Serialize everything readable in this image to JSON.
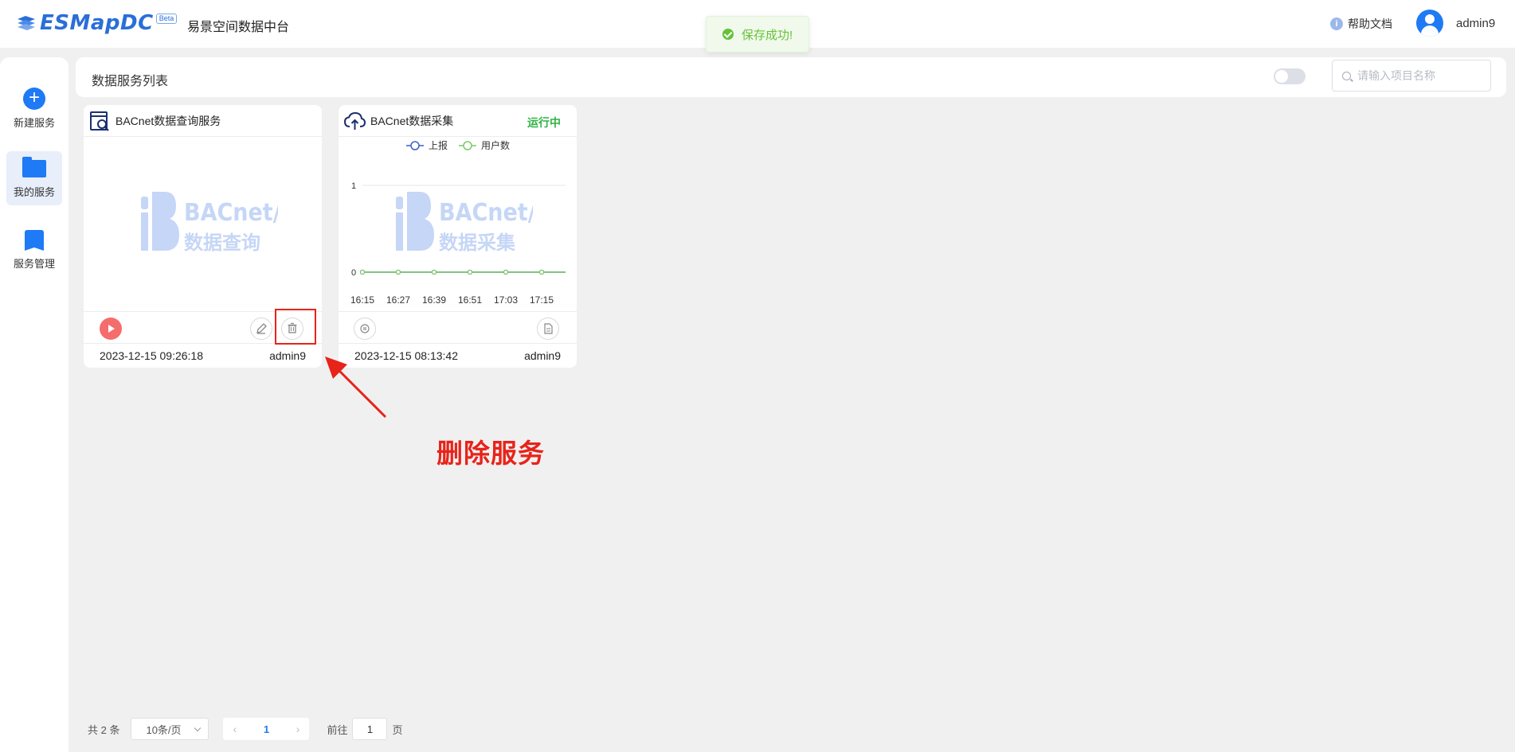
{
  "header": {
    "logo_text": "ESMapDC",
    "logo_badge": "Beta",
    "app_name": "易景空间数据中台",
    "help_label": "帮助文档",
    "username": "admin9"
  },
  "toast": {
    "message": "保存成功!"
  },
  "sidebar": {
    "items": [
      {
        "label": "新建服务",
        "icon": "plus-circle-icon"
      },
      {
        "label": "我的服务",
        "icon": "folder-icon",
        "active": true
      },
      {
        "label": "服务管理",
        "icon": "book-icon"
      }
    ]
  },
  "toolbar": {
    "title": "数据服务列表",
    "search_placeholder": "请输入项目名称"
  },
  "cards": [
    {
      "title": "BACnet数据查询服务",
      "status": "",
      "watermark_title": "BACnet/IP",
      "watermark_subtitle": "数据查询",
      "date": "2023-12-15 09:26:18",
      "owner": "admin9"
    },
    {
      "title": "BACnet数据采集",
      "status": "运行中",
      "watermark_title": "BACnet/IP",
      "watermark_subtitle": "数据采集",
      "date": "2023-12-15 08:13:42",
      "owner": "admin9"
    }
  ],
  "chart_data": {
    "type": "line",
    "categories": [
      "16:15",
      "16:27",
      "16:39",
      "16:51",
      "17:03",
      "17:15"
    ],
    "series": [
      {
        "name": "上报",
        "values": [
          0,
          0,
          0,
          0,
          0,
          0
        ],
        "color": "#3f5fc4"
      },
      {
        "name": "用户数",
        "values": [
          0,
          0,
          0,
          0,
          0,
          0
        ],
        "color": "#7cc868"
      }
    ],
    "yticks": [
      "0",
      "1"
    ],
    "ylim": [
      0,
      1
    ],
    "legend": "top"
  },
  "annotation": {
    "text": "删除服务",
    "color": "#e8231a"
  },
  "pagination": {
    "total": "共 2 条",
    "page_size": "10条/页",
    "current_page": "1",
    "prev": "‹",
    "next": "›",
    "goto_prefix": "前往",
    "goto_value": "1",
    "goto_suffix": "页"
  }
}
